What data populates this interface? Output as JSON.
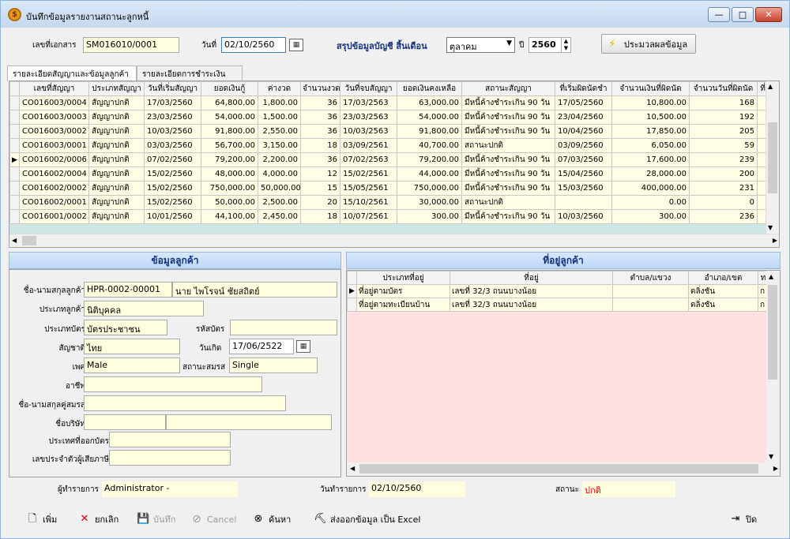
{
  "window": {
    "title": "บันทึกข้อมูลรายงานสถานะลูกหนี้",
    "minimize": "—",
    "maximize": "□",
    "close": "✕"
  },
  "header": {
    "doc_no_label": "เลขที่เอกสาร",
    "doc_no_value": "SM016010/0001",
    "date_label": "วันที่",
    "date_value": "02/10/2560",
    "summary_label": "สรุปข้อมูลบัญชี สิ้นเดือน",
    "month_value": "ตุลาคม",
    "year_label": "ปี",
    "year_value": "2560",
    "process_button": "ประมวลผลข้อมูล"
  },
  "tabs": [
    {
      "label": "รายละเอียดสัญญาและข้อมูลลูกค้า"
    },
    {
      "label": "รายละเอียดการชำระเงิน"
    }
  ],
  "grid": {
    "columns": [
      "เลขที่สัญญา",
      "ประเภทสัญญา",
      "วันที่เริ่มสัญญา",
      "ยอดเงินกู้",
      "ค่างวด",
      "จำนวนงวด",
      "วันที่จบสัญญา",
      "ยอดเงินคงเหลือ",
      "สถานะสัญญา",
      "ที่เริ่มผิดนัดชำ",
      "จำนวนเงินที่ผิดนัด",
      "จำนวนวันที่ผิดนัด",
      "ที่"
    ],
    "rows": [
      [
        "CO016003/0004",
        "สัญญาปกติ",
        "17/03/2560",
        "64,800.00",
        "1,800.00",
        "36",
        "17/03/2563",
        "63,000.00",
        "มีหนี้ค้างชำระเกิน 90 วัน",
        "17/05/2560",
        "10,800.00",
        "168",
        ""
      ],
      [
        "CO016003/0003",
        "สัญญาปกติ",
        "23/03/2560",
        "54,000.00",
        "1,500.00",
        "36",
        "23/03/2563",
        "54,000.00",
        "มีหนี้ค้างชำระเกิน 90 วัน",
        "23/04/2560",
        "10,500.00",
        "192",
        ""
      ],
      [
        "CO016003/0002",
        "สัญญาปกติ",
        "10/03/2560",
        "91,800.00",
        "2,550.00",
        "36",
        "10/03/2563",
        "91,800.00",
        "มีหนี้ค้างชำระเกิน 90 วัน",
        "10/04/2560",
        "17,850.00",
        "205",
        ""
      ],
      [
        "CO016003/0001",
        "สัญญาปกติ",
        "03/03/2560",
        "56,700.00",
        "3,150.00",
        "18",
        "03/09/2561",
        "40,700.00",
        "สถานะปกติ",
        "03/09/2560",
        "6,050.00",
        "59",
        ""
      ],
      [
        "CO016002/0006",
        "สัญญาปกติ",
        "07/02/2560",
        "79,200.00",
        "2,200.00",
        "36",
        "07/02/2563",
        "79,200.00",
        "มีหนี้ค้างชำระเกิน 90 วัน",
        "07/03/2560",
        "17,600.00",
        "239",
        ""
      ],
      [
        "CO016002/0004",
        "สัญญาปกติ",
        "15/02/2560",
        "48,000.00",
        "4,000.00",
        "12",
        "15/02/2561",
        "44,000.00",
        "มีหนี้ค้างชำระเกิน 90 วัน",
        "15/04/2560",
        "28,000.00",
        "200",
        ""
      ],
      [
        "CO016002/0002",
        "สัญญาปกติ",
        "15/02/2560",
        "750,000.00",
        "50,000.00",
        "15",
        "15/05/2561",
        "750,000.00",
        "มีหนี้ค้างชำระเกิน 90 วัน",
        "15/03/2560",
        "400,000.00",
        "231",
        ""
      ],
      [
        "CO016002/0001",
        "สัญญาปกติ",
        "15/02/2560",
        "50,000.00",
        "2,500.00",
        "20",
        "15/10/2561",
        "30,000.00",
        "สถานะปกติ",
        "",
        "0.00",
        "0",
        ""
      ],
      [
        "CO016001/0002",
        "สัญญาปกติ",
        "10/01/2560",
        "44,100.00",
        "2,450.00",
        "18",
        "10/07/2561",
        "300.00",
        "มีหนี้ค้างชำระเกิน 90 วัน",
        "10/03/2560",
        "300.00",
        "236",
        ""
      ]
    ],
    "selected_row": 4
  },
  "customer": {
    "panel_title": "ข้อมูลลูกค้า",
    "name_label": "ชื่อ-นามสกุลลูกค้า",
    "customer_code": "HPR-0002-00001",
    "customer_name": "นาย ไพโรจน์ ชัยสถิตย์",
    "type_label": "ประเภทลูกค้า",
    "type_value": "นิติบุคคล",
    "card_type_label": "ประเภทบัตร",
    "card_type_value": "บัตรประชาชน",
    "card_no_label": "รหัสบัตร",
    "card_no_value": "",
    "nationality_label": "สัญชาติ",
    "nationality_value": "ไทย",
    "birth_label": "วันเกิด",
    "birth_value": "17/06/2522",
    "gender_label": "เพศ",
    "gender_value": "Male",
    "marital_label": "สถานะสมรส",
    "marital_value": "Single",
    "occupation_label": "อาชีพ",
    "spouse_label": "ชื่อ-นามสกุลคู่สมรส",
    "company_label": "ชื่อบริษัท",
    "issue_country_label": "ประเทศที่ออกบัตร",
    "tax_id_label": "เลขประจำตัวผู้เสียภาษี"
  },
  "address": {
    "panel_title": "ที่อยู่ลูกค้า",
    "columns": [
      "ประเภทที่อยู่",
      "ที่อยู่",
      "ตำบล/แขวง",
      "อำเภอ/เขต",
      "ท"
    ],
    "rows": [
      [
        "ที่อยู่ตามบัตร",
        "เลขที่ 32/3   ถนนบางน้อย",
        "",
        "ตลิ่งชัน",
        "ก"
      ],
      [
        "ที่อยู่ตามทะเบียนบ้าน",
        "เลขที่ 32/3   ถนนบางน้อย",
        "",
        "ตลิ่งชัน",
        "ก"
      ]
    ]
  },
  "status": {
    "operator_label": "ผู้ทำรายการ",
    "operator_value": "Administrator -",
    "tx_date_label": "วันทำรายการ",
    "tx_date_value": "02/10/2560",
    "state_label": "สถานะ",
    "state_value": "ปกติ"
  },
  "toolbar": {
    "add": "เพิ่ม",
    "cancel_th": "ยกเลิก",
    "save": "บันทึก",
    "cancel_en": "Cancel",
    "search": "ค้นหา",
    "export": "ส่งออกข้อมูล เป็น Excel",
    "close": "ปิด"
  },
  "colors": {
    "accent": "#15317e",
    "status_red": "#e00000",
    "grid_row": "#fffde3",
    "address_bg": "#ffe0e0"
  }
}
